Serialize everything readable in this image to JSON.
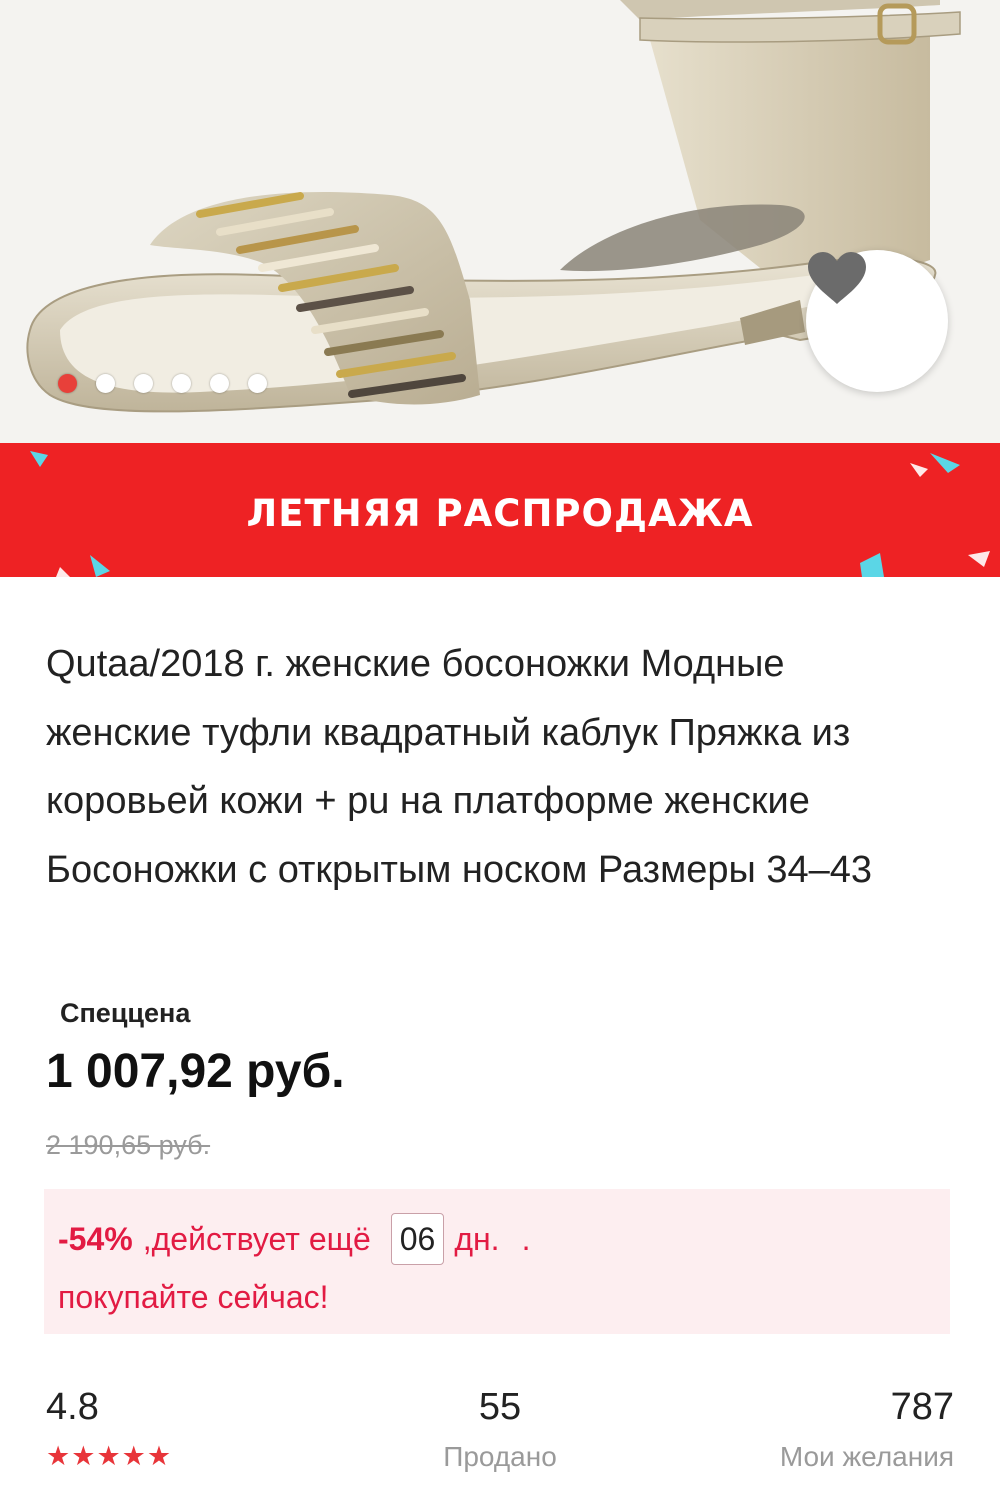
{
  "gallery": {
    "slide_count": 6,
    "active_slide": 1
  },
  "banner": {
    "text": "ЛЕТНЯЯ РАСПРОДАЖА",
    "color": "#ee2224"
  },
  "product": {
    "title": "Qutaa/2018 г. женские босоножки Модные женские туфли квадратный каблук Пряжка из коровьей кожи + pu на платформе женские Босоножки с открытым носком Размеры 34–43",
    "price_label": "Спеццена",
    "price": "1 007,92 руб.",
    "old_price": "2 190,65 руб."
  },
  "promo": {
    "discount": "-54%",
    "text_before_days": ",действует ещё",
    "days": "06",
    "days_unit": "дн.",
    "dot": ".",
    "line2": "покупайте сейчас!",
    "accent": "#e21b43"
  },
  "stats": {
    "rating": "4.8",
    "stars": 5,
    "sold_count": "55",
    "sold_label": "Продано",
    "wishes_count": "787",
    "wishes_label": "Мои желания"
  },
  "icons": {
    "wishlist": "heart-icon",
    "rating": "star-icon"
  }
}
